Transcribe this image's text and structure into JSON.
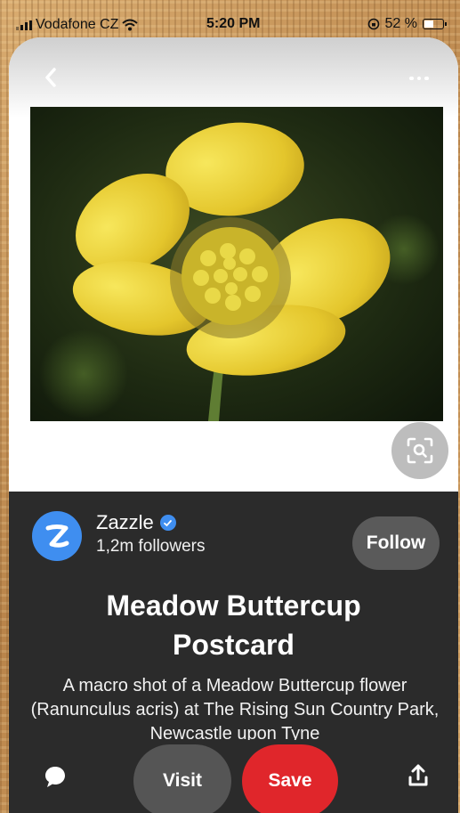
{
  "status_bar": {
    "carrier": "Vodafone CZ",
    "time": "5:20 PM",
    "battery": "52 %",
    "battery_level": 0.52
  },
  "pin": {
    "image_icon": "flower-photo",
    "creator": {
      "name": "Zazzle",
      "followers": "1,2m followers",
      "avatar_letter": "Z"
    },
    "follow_label": "Follow",
    "title": "Meadow Buttercup Postcard",
    "description": "A macro shot of a Meadow Buttercup flower (Ranunculus acris) at The Rising Sun Country Park, Newcastle upon Tyne"
  },
  "actions": {
    "visit_label": "Visit",
    "save_label": "Save"
  },
  "colors": {
    "save": "#e0262b",
    "verified": "#3f8ef0",
    "panel": "#2b2b2b"
  }
}
